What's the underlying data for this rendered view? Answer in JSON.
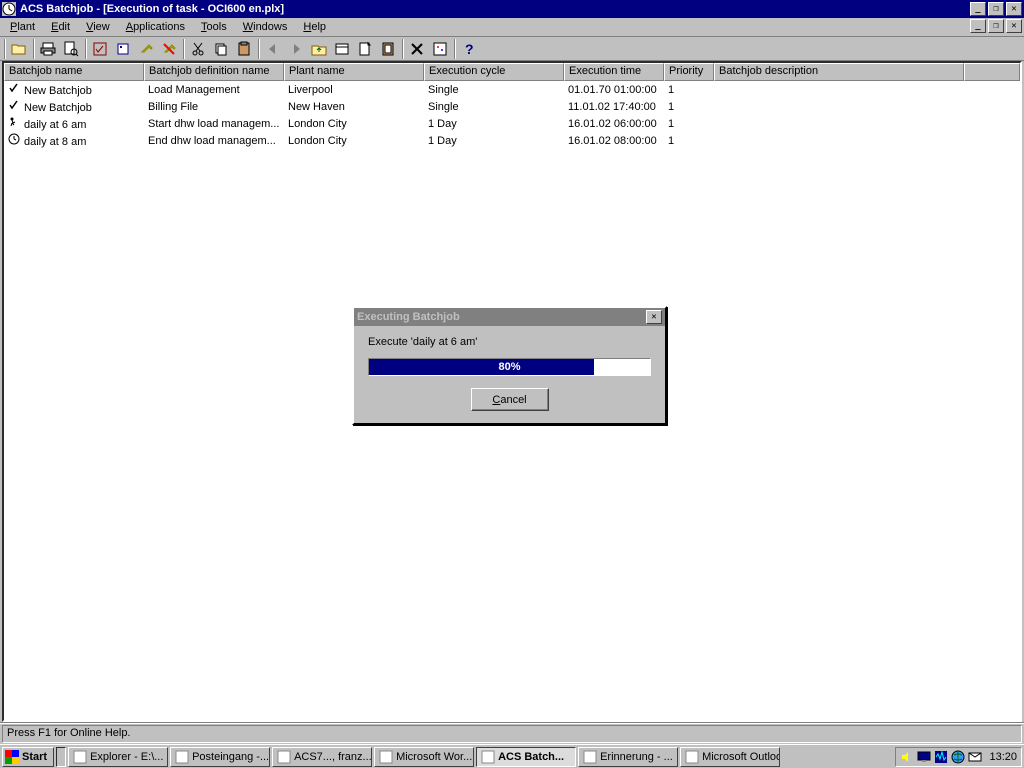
{
  "window": {
    "title": "ACS Batchjob - [Execution of task - OCI600 en.plx]"
  },
  "menu": [
    "Plant",
    "Edit",
    "View",
    "Applications",
    "Tools",
    "Windows",
    "Help"
  ],
  "columns": [
    "Batchjob name",
    "Batchjob definition name",
    "Plant name",
    "Execution cycle",
    "Execution time",
    "Priority",
    "Batchjob description"
  ],
  "rows": [
    {
      "icon": "check",
      "name": "New Batchjob",
      "def": "Load Management",
      "plant": "Liverpool",
      "cycle": "Single",
      "time": "01.01.70 01:00:00",
      "prio": "1",
      "desc": ""
    },
    {
      "icon": "check",
      "name": "New Batchjob",
      "def": "Billing File",
      "plant": "New Haven",
      "cycle": "Single",
      "time": "11.01.02 17:40:00",
      "prio": "1",
      "desc": ""
    },
    {
      "icon": "run",
      "name": "daily at 6 am",
      "def": "Start dhw load managem...",
      "plant": "London City",
      "cycle": "1 Day",
      "time": "16.01.02 06:00:00",
      "prio": "1",
      "desc": ""
    },
    {
      "icon": "clock",
      "name": "daily at 8 am",
      "def": "End dhw load managem...",
      "plant": "London City",
      "cycle": "1 Day",
      "time": "16.01.02 08:00:00",
      "prio": "1",
      "desc": ""
    }
  ],
  "dialog": {
    "title": "Executing Batchjob",
    "message": "Execute 'daily at 6 am'",
    "percent": 80,
    "percent_label": "80%",
    "cancel": "Cancel"
  },
  "status": "Press F1 for Online Help.",
  "taskbar": {
    "start": "Start",
    "items": [
      {
        "label": "Explorer - E:\\...",
        "active": false
      },
      {
        "label": "Posteingang -...",
        "active": false
      },
      {
        "label": "ACS7..., franz...",
        "active": false
      },
      {
        "label": "Microsoft Wor...",
        "active": false
      },
      {
        "label": "ACS Batch...",
        "active": true
      },
      {
        "label": "Erinnerung - ...",
        "active": false
      },
      {
        "label": "Microsoft Outlook",
        "active": false
      }
    ],
    "clock": "13:20"
  }
}
